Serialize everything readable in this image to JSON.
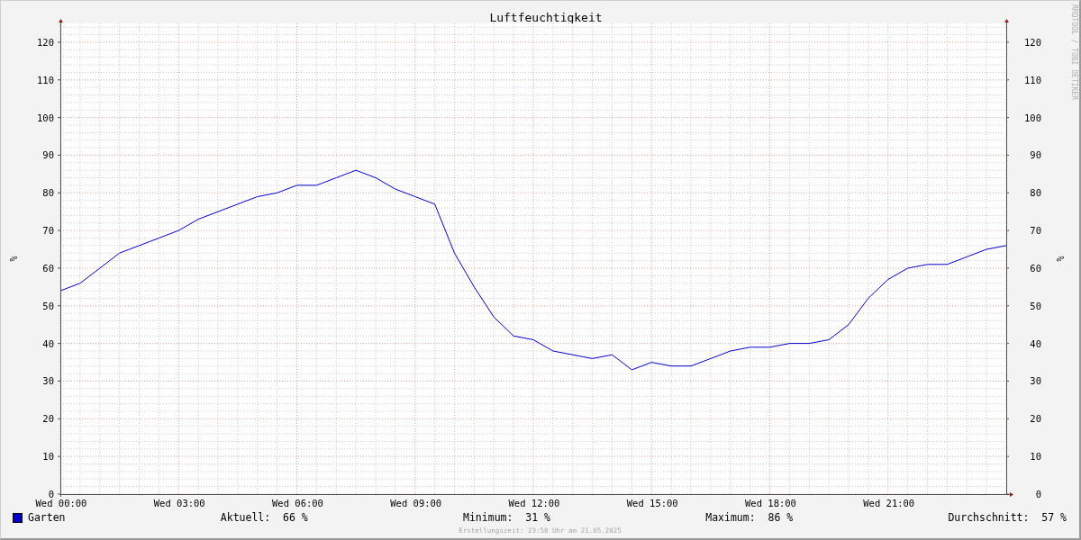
{
  "chart_data": {
    "type": "line",
    "title": "Luftfeuchtigkeit",
    "ylabel": "%",
    "ylim": [
      0,
      125
    ],
    "grid": true,
    "categories": [
      "Wed 00:00",
      null,
      null,
      null,
      null,
      null,
      "Wed 03:00",
      null,
      null,
      null,
      null,
      null,
      "Wed 06:00",
      null,
      null,
      null,
      null,
      null,
      "Wed 09:00",
      null,
      null,
      null,
      null,
      null,
      "Wed 12:00",
      null,
      null,
      null,
      null,
      null,
      "Wed 15:00",
      null,
      null,
      null,
      null,
      null,
      "Wed 18:00",
      null,
      null,
      null,
      null,
      null,
      "Wed 21:00",
      null,
      null,
      null,
      null,
      null,
      null
    ],
    "yticks": [
      0,
      10,
      20,
      30,
      40,
      50,
      60,
      70,
      80,
      90,
      100,
      110,
      120
    ],
    "series": [
      {
        "name": "Garten",
        "color": "#0000cc",
        "values": [
          54,
          56,
          60,
          64,
          66,
          68,
          70,
          73,
          75,
          77,
          79,
          80,
          82,
          82,
          84,
          86,
          84,
          81,
          79,
          77,
          64,
          55,
          47,
          42,
          41,
          38,
          37,
          36,
          37,
          33,
          35,
          34,
          34,
          36,
          38,
          39,
          39,
          40,
          40,
          41,
          45,
          52,
          57,
          60,
          61,
          61,
          63,
          65,
          66
        ]
      }
    ]
  },
  "right_yticks": [
    "120",
    "110",
    "100",
    "90",
    "80",
    "70",
    "60",
    "50",
    "40",
    "30",
    "20",
    "10",
    "0"
  ],
  "right_ylabel": "%",
  "credit": "RRDTOOL / TOBI OETIKER",
  "stats": [
    {
      "label": "Aktuell:",
      "value": "66 %"
    },
    {
      "label": "Minimum:",
      "value": "31 %"
    },
    {
      "label": "Maximum:",
      "value": "86 %"
    },
    {
      "label": "Durchschnitt:",
      "value": "57 %"
    }
  ],
  "footer": "Erstellungszeit: 23:58 Uhr am 21.05.2025"
}
